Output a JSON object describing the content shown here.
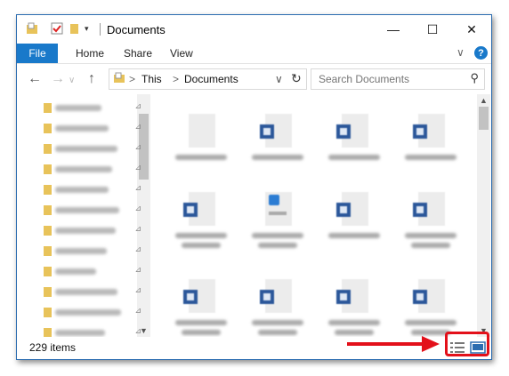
{
  "window": {
    "title": "Documents"
  },
  "window_controls": {
    "minimize": "—",
    "maximize": "☐",
    "close": "✕"
  },
  "ribbon": {
    "file": "File",
    "tabs": [
      "Home",
      "Share",
      "View"
    ],
    "help": "?",
    "expand": "∨"
  },
  "nav": {
    "back": "←",
    "forward": "→",
    "up": "↑",
    "path_chevron": ">",
    "path": [
      "This",
      "Documents"
    ],
    "dropdown": "∨",
    "refresh": "↻"
  },
  "search": {
    "placeholder": "Search Documents",
    "icon": "⚲"
  },
  "sidebar": {
    "pin": "⊿",
    "items": [
      {
        "icon": "folder-icon",
        "color": "#e8c35a"
      },
      {
        "icon": "folder-icon",
        "color": "#e8c35a"
      },
      {
        "icon": "folder-icon",
        "color": "#e8c35a"
      },
      {
        "icon": "folder-icon",
        "color": "#e8c35a"
      },
      {
        "icon": "folder-icon",
        "color": "#e8c35a"
      },
      {
        "icon": "folder-icon",
        "color": "#e8c35a"
      },
      {
        "icon": "folder-icon",
        "color": "#e8c35a"
      },
      {
        "icon": "folder-icon",
        "color": "#e8c35a"
      },
      {
        "icon": "folder-icon",
        "color": "#e8c35a"
      },
      {
        "icon": "folder-icon",
        "color": "#e8c35a"
      },
      {
        "icon": "folder-icon",
        "color": "#e8c35a"
      },
      {
        "icon": "folder-icon",
        "color": "#e8c35a"
      }
    ]
  },
  "files": [
    {
      "type": "generic"
    },
    {
      "type": "word"
    },
    {
      "type": "word"
    },
    {
      "type": "word"
    },
    {
      "type": "word"
    },
    {
      "type": "pdf"
    },
    {
      "type": "word"
    },
    {
      "type": "word"
    },
    {
      "type": "word"
    },
    {
      "type": "word"
    },
    {
      "type": "word"
    },
    {
      "type": "word"
    }
  ],
  "scroll": {
    "up": "▲",
    "down": "▼"
  },
  "status": {
    "item_count": "229 items"
  },
  "annotation": {
    "color": "#e3101a"
  }
}
